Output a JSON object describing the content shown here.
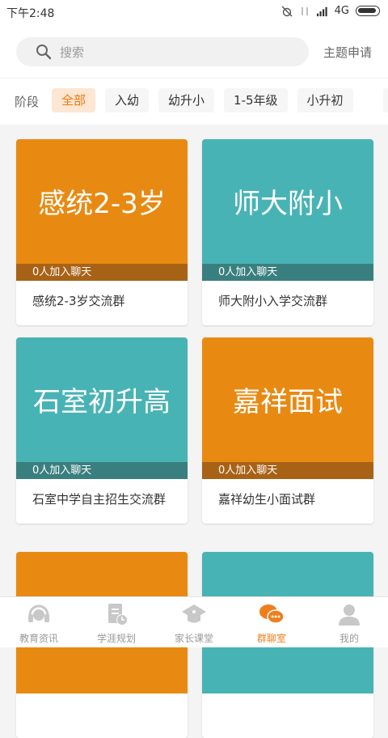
{
  "status": {
    "time": "下午2:48",
    "network": "4G"
  },
  "search": {
    "placeholder": "搜索",
    "apply_label": "主题申请"
  },
  "filters": {
    "label": "阶段",
    "chips": [
      "全部",
      "入幼",
      "幼升小",
      "1-5年级",
      "小升初"
    ],
    "active_index": 0
  },
  "cards": [
    {
      "cover_text": "感统2-3岁",
      "count_text": "0人加入聊天",
      "name": "感统2-3岁交流群",
      "color": "#e88a12",
      "strip": "#a86216"
    },
    {
      "cover_text": "师大附小",
      "count_text": "0人加入聊天",
      "name": "师大附小入学交流群",
      "color": "#48b3b5",
      "strip": "#3a7f7f"
    },
    {
      "cover_text": "石室初升高",
      "count_text": "0人加入聊天",
      "name": "石室中学自主招生交流群",
      "color": "#48b3b5",
      "strip": "#3a7f7f"
    },
    {
      "cover_text": "嘉祥面试",
      "count_text": "0人加入聊天",
      "name": "嘉祥幼生小面试群",
      "color": "#e88a12",
      "strip": "#a86216"
    }
  ],
  "partial_cards": [
    {
      "color": "#e88a12"
    },
    {
      "color": "#48b3b5"
    }
  ],
  "tabs": [
    {
      "label": "教育资讯",
      "icon": "headset-icon",
      "active": false
    },
    {
      "label": "学涯规划",
      "icon": "document-clock-icon",
      "active": false
    },
    {
      "label": "家长课堂",
      "icon": "graduation-cap-icon",
      "active": false
    },
    {
      "label": "群聊室",
      "icon": "chat-bubbles-icon",
      "active": true
    },
    {
      "label": "我的",
      "icon": "user-icon",
      "active": false
    }
  ],
  "colors": {
    "accent": "#ef7e1d",
    "orange_card": "#e88a12",
    "teal_card": "#48b3b5"
  }
}
